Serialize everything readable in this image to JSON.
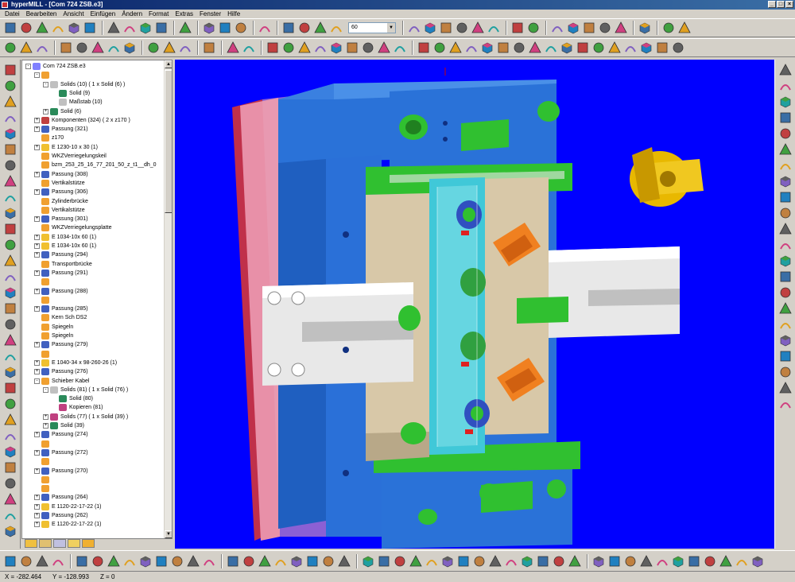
{
  "window": {
    "title": "hyperMILL - [Com 724 ZSB.e3]"
  },
  "menu": [
    "Datei",
    "Bearbeiten",
    "Ansicht",
    "Einfügen",
    "Ändern",
    "Format",
    "Extras",
    "Fenster",
    "Hilfe"
  ],
  "toolbar": {
    "color_value": "60"
  },
  "tree": [
    {
      "label": "Com 724 ZSB.e3",
      "indent": 0,
      "exp": "-",
      "icon": "#8080ff"
    },
    {
      "label": "",
      "indent": 1,
      "exp": "-",
      "icon": "#f0a030"
    },
    {
      "label": "Solids (10) ( 1 x Solid (6) )",
      "indent": 2,
      "exp": "-",
      "icon": "#c0c0c0"
    },
    {
      "label": "Solid (9)",
      "indent": 3,
      "exp": "",
      "icon": "#2a8a5a"
    },
    {
      "label": "Maßstab (10)",
      "indent": 3,
      "exp": "",
      "icon": "#c0c0c0"
    },
    {
      "label": "Solid (6)",
      "indent": 2,
      "exp": "+",
      "icon": "#2a8a5a"
    },
    {
      "label": "Komponenten (324) ( 2 x z170 )",
      "indent": 1,
      "exp": "+",
      "icon": "#c04040"
    },
    {
      "label": "Passung (321)",
      "indent": 1,
      "exp": "+",
      "icon": "#4060c0"
    },
    {
      "label": "z170",
      "indent": 1,
      "exp": "",
      "icon": "#f0a030"
    },
    {
      "label": "E 1230-10 x 30 (1)",
      "indent": 1,
      "exp": "+",
      "icon": "#f0c030"
    },
    {
      "label": "WKZVerriegelungskeil",
      "indent": 1,
      "exp": "",
      "icon": "#f0a030"
    },
    {
      "label": "bzm_253_25_16_77_201_50_z_t1__dh_0",
      "indent": 1,
      "exp": "",
      "icon": "#f0a030"
    },
    {
      "label": "Passung (308)",
      "indent": 1,
      "exp": "+",
      "icon": "#4060c0"
    },
    {
      "label": "Vertikalstütze",
      "indent": 1,
      "exp": "",
      "icon": "#f0a030"
    },
    {
      "label": "Passung (306)",
      "indent": 1,
      "exp": "+",
      "icon": "#4060c0"
    },
    {
      "label": "Zylinderbrücke",
      "indent": 1,
      "exp": "",
      "icon": "#f0a030"
    },
    {
      "label": "Vertikalstütze",
      "indent": 1,
      "exp": "",
      "icon": "#f0a030"
    },
    {
      "label": "Passung (301)",
      "indent": 1,
      "exp": "+",
      "icon": "#4060c0"
    },
    {
      "label": "WKZVerriegelungsplatte",
      "indent": 1,
      "exp": "",
      "icon": "#f0a030"
    },
    {
      "label": "E 1034-10x  60 (1)",
      "indent": 1,
      "exp": "+",
      "icon": "#f0c030"
    },
    {
      "label": "E 1034-10x  60 (1)",
      "indent": 1,
      "exp": "+",
      "icon": "#f0c030"
    },
    {
      "label": "Passung (294)",
      "indent": 1,
      "exp": "+",
      "icon": "#4060c0"
    },
    {
      "label": "Transportbrücke",
      "indent": 1,
      "exp": "",
      "icon": "#f0a030"
    },
    {
      "label": "Passung (291)",
      "indent": 1,
      "exp": "+",
      "icon": "#4060c0"
    },
    {
      "label": "",
      "indent": 1,
      "exp": "",
      "icon": "#f0a030"
    },
    {
      "label": "Passung (288)",
      "indent": 1,
      "exp": "+",
      "icon": "#4060c0"
    },
    {
      "label": "",
      "indent": 1,
      "exp": "",
      "icon": "#f0a030"
    },
    {
      "label": "Passung (285)",
      "indent": 1,
      "exp": "+",
      "icon": "#4060c0"
    },
    {
      "label": "Kern Sch DS2",
      "indent": 1,
      "exp": "",
      "icon": "#f0a030"
    },
    {
      "label": "Spiegeln",
      "indent": 1,
      "exp": "",
      "icon": "#f0a030"
    },
    {
      "label": "Spiegeln",
      "indent": 1,
      "exp": "",
      "icon": "#f0a030"
    },
    {
      "label": "Passung (279)",
      "indent": 1,
      "exp": "+",
      "icon": "#4060c0"
    },
    {
      "label": "",
      "indent": 1,
      "exp": "",
      "icon": "#f0a030"
    },
    {
      "label": "E 1040-34 x   98-260-26 (1)",
      "indent": 1,
      "exp": "+",
      "icon": "#f0c030"
    },
    {
      "label": "Passung (276)",
      "indent": 1,
      "exp": "+",
      "icon": "#4060c0"
    },
    {
      "label": "Schieber Kabel",
      "indent": 1,
      "exp": "-",
      "icon": "#f0a030"
    },
    {
      "label": "Solids (81) ( 1 x Solid (76) )",
      "indent": 2,
      "exp": "-",
      "icon": "#c0c0c0"
    },
    {
      "label": "Solid (80)",
      "indent": 3,
      "exp": "",
      "icon": "#2a8a5a"
    },
    {
      "label": "Kopieren (81)",
      "indent": 3,
      "exp": "",
      "icon": "#c04080"
    },
    {
      "label": "Solids (77) ( 1 x Solid (39) )",
      "indent": 2,
      "exp": "+",
      "icon": "#c04080"
    },
    {
      "label": "Solid (39)",
      "indent": 2,
      "exp": "+",
      "icon": "#2a8a5a"
    },
    {
      "label": "Passung (274)",
      "indent": 1,
      "exp": "+",
      "icon": "#4060c0"
    },
    {
      "label": "",
      "indent": 1,
      "exp": "",
      "icon": "#f0a030"
    },
    {
      "label": "Passung (272)",
      "indent": 1,
      "exp": "+",
      "icon": "#4060c0"
    },
    {
      "label": "",
      "indent": 1,
      "exp": "",
      "icon": "#f0a030"
    },
    {
      "label": "Passung (270)",
      "indent": 1,
      "exp": "+",
      "icon": "#4060c0"
    },
    {
      "label": "",
      "indent": 1,
      "exp": "",
      "icon": "#f0a030"
    },
    {
      "label": "",
      "indent": 1,
      "exp": "",
      "icon": "#f0a030"
    },
    {
      "label": "Passung (264)",
      "indent": 1,
      "exp": "+",
      "icon": "#4060c0"
    },
    {
      "label": "E 1120-22-17-22 (1)",
      "indent": 1,
      "exp": "+",
      "icon": "#f0c030"
    },
    {
      "label": "Passung (262)",
      "indent": 1,
      "exp": "+",
      "icon": "#4060c0"
    },
    {
      "label": "E 1120-22-17-22 (1)",
      "indent": 1,
      "exp": "+",
      "icon": "#f0c030"
    }
  ],
  "status": {
    "x": "X = -282.464",
    "y": "Y = -128.993",
    "z": "Z = 0"
  }
}
